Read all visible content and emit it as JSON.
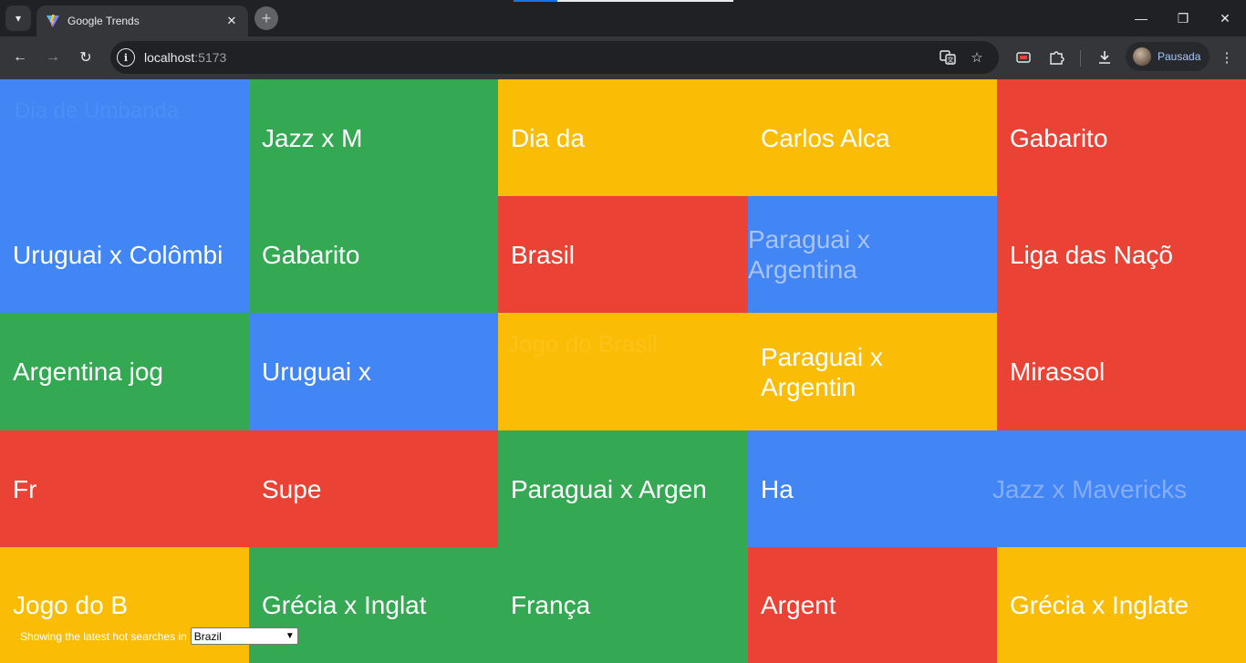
{
  "browser": {
    "tab_title": "Google Trends",
    "url_host": "localhost",
    "url_port": ":5173",
    "profile_label": "Pausada"
  },
  "colors": {
    "blue": "#4285f4",
    "green": "#34a853",
    "yellow": "#fbbc05",
    "red": "#ea4335"
  },
  "grid": {
    "cells": [
      {
        "text": "Dia de Umbanda",
        "color": "blue",
        "faded": true
      },
      {
        "text": "Jazz x M",
        "color": "green"
      },
      {
        "text": "Dia da",
        "color": "yellow"
      },
      {
        "text": "Carlos Alca",
        "color": "yellow"
      },
      {
        "text": "Gabarito",
        "color": "red"
      },
      {
        "text": "Uruguai x Colômbi",
        "color": "blue"
      },
      {
        "text": "Gabarito",
        "color": "green"
      },
      {
        "text": "Brasil",
        "color": "red"
      },
      {
        "text": "Paraguai x Argentina",
        "color": "blue",
        "faded": true
      },
      {
        "text": "Liga das Naçõ",
        "color": "red"
      },
      {
        "text": "Argentina jog",
        "color": "green"
      },
      {
        "text": "Uruguai x",
        "color": "blue"
      },
      {
        "text": "Jogo do Brasil",
        "color": "yellow",
        "faded": true
      },
      {
        "text": "Paraguai x Argentin",
        "color": "yellow"
      },
      {
        "text": "Mirassol",
        "color": "red"
      },
      {
        "text": "Fr",
        "color": "red"
      },
      {
        "text": "Supe",
        "color": "red"
      },
      {
        "text": "Paraguai x Argen",
        "color": "green"
      },
      {
        "text": "Ha",
        "color": "blue"
      },
      {
        "text": "Jazz x Mavericks",
        "color": "blue",
        "faded": true
      },
      {
        "text": "Jogo do B",
        "color": "yellow"
      },
      {
        "text": "Grécia x Inglat",
        "color": "green"
      },
      {
        "text": "França",
        "color": "green"
      },
      {
        "text": "Argent",
        "color": "red"
      },
      {
        "text": "Grécia x Inglate",
        "color": "yellow"
      }
    ]
  },
  "footer": {
    "label": "Showing the latest hot searches in",
    "selected_country": "Brazil"
  }
}
